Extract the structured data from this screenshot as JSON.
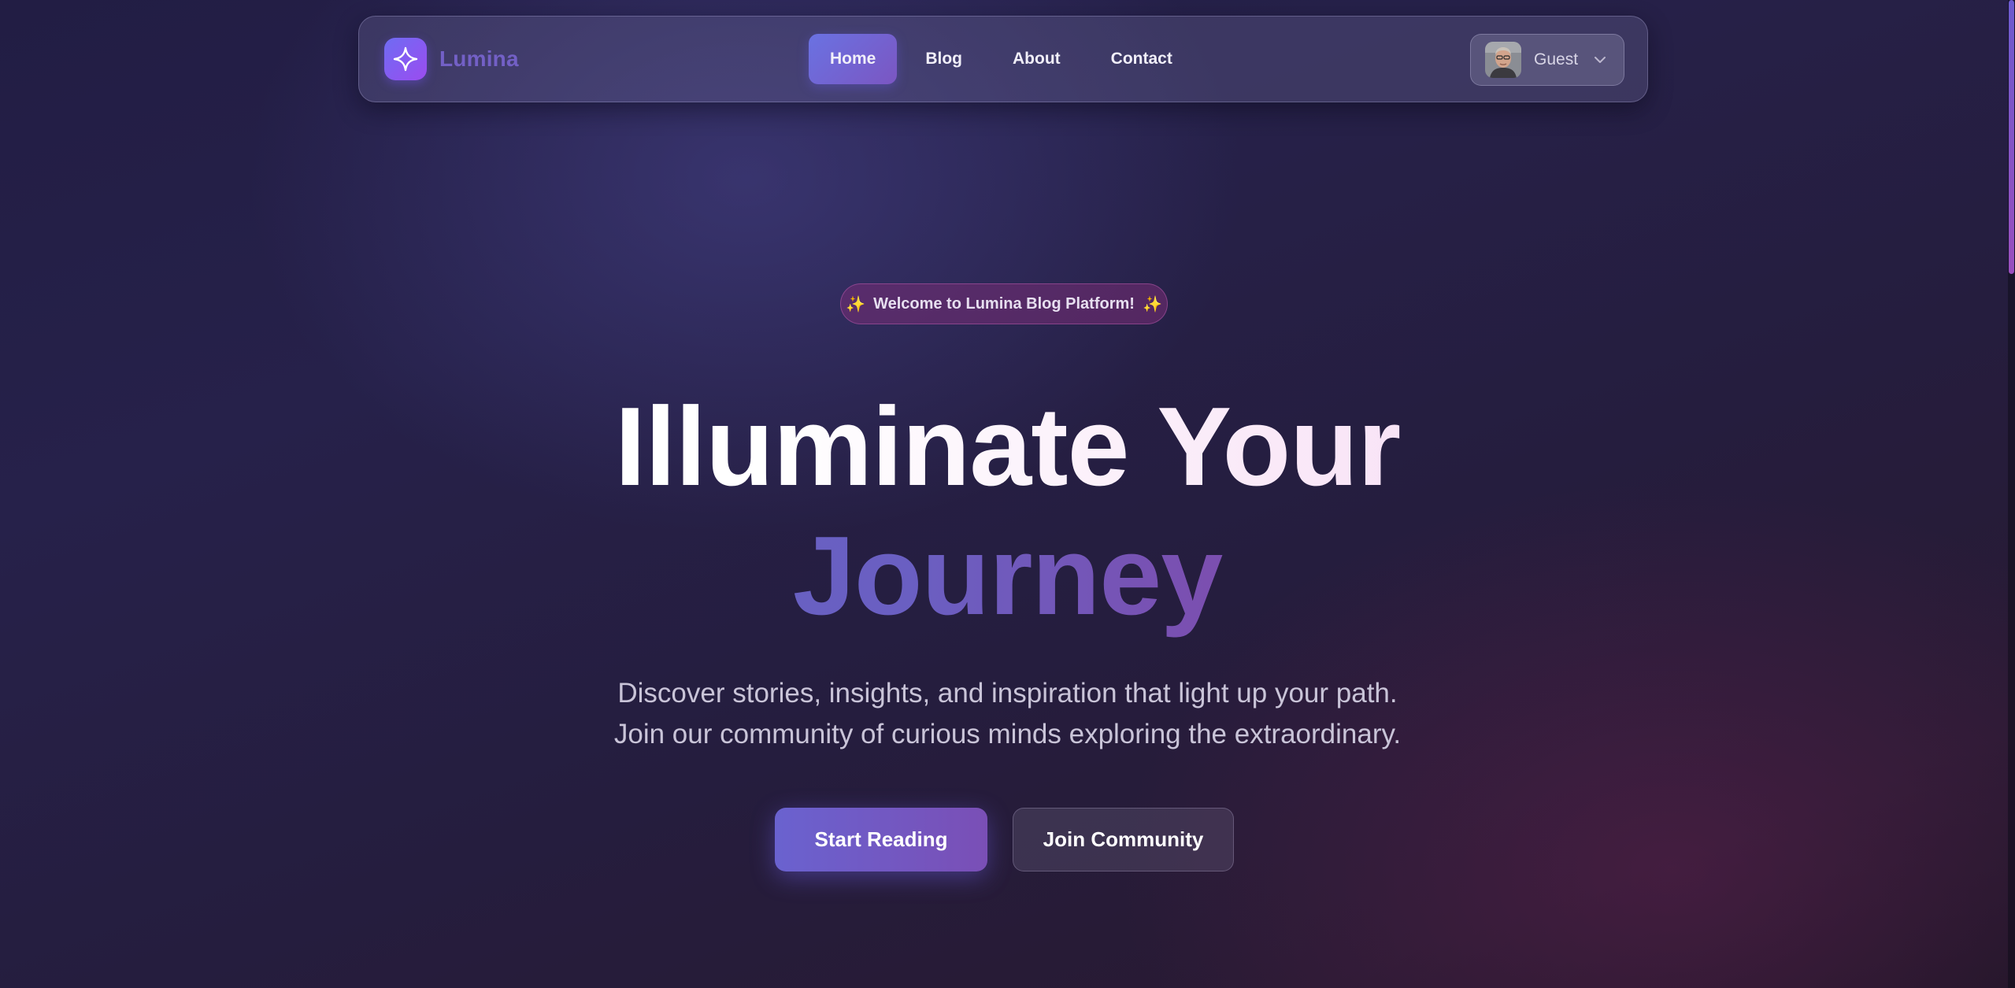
{
  "brand": {
    "name": "Lumina",
    "icon": "sparkle-icon",
    "accent": "#7360c6"
  },
  "nav": {
    "items": [
      {
        "label": "Home",
        "active": true
      },
      {
        "label": "Blog",
        "active": false
      },
      {
        "label": "About",
        "active": false
      },
      {
        "label": "Contact",
        "active": false
      }
    ]
  },
  "user": {
    "name": "Guest",
    "avatar_icon": "avatar",
    "menu_icon": "chevron-down-icon"
  },
  "hero": {
    "badge": {
      "text": "Welcome to Lumina Blog Platform!",
      "icon": "sparkles-emoji"
    },
    "headline_line1": "Illuminate Your",
    "headline_line2": "Journey",
    "subtitle_line1": "Discover stories, insights, and inspiration that light up your path.",
    "subtitle_line2": "Join our community of curious minds exploring the extraordinary.",
    "primary_cta": "Start Reading",
    "secondary_cta": "Join Community"
  },
  "colors": {
    "background": "#241e42",
    "primary_gradient_start": "#6a62cf",
    "primary_gradient_end": "#7a4fb6",
    "badge_bg": "#782e76"
  }
}
